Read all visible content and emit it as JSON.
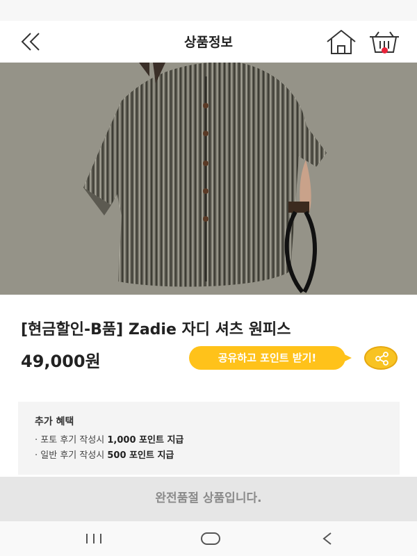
{
  "header": {
    "title": "상품정보"
  },
  "product": {
    "title": "[현금할인-B품] Zadie 자디 셔츠 원피스",
    "price": "49,000원"
  },
  "share": {
    "label": "공유하고 포인트 받기!"
  },
  "benefits": {
    "title": "추가 혜택",
    "lines": [
      {
        "prefix": "· 포토 후기 작성시 ",
        "points": "1,000 포인트 지급"
      },
      {
        "prefix": "· 일반 후기 작성시 ",
        "points": "500 포인트 지급"
      }
    ]
  },
  "soldout": {
    "label": "완전품절 상품입니다."
  },
  "colors": {
    "accent": "#ffc21a",
    "cart_badge": "#e8233a"
  }
}
